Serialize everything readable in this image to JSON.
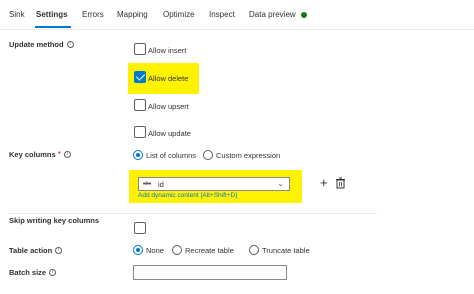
{
  "tabs": [
    {
      "label": "Sink"
    },
    {
      "label": "Settings"
    },
    {
      "label": "Errors"
    },
    {
      "label": "Mapping"
    },
    {
      "label": "Optimize"
    },
    {
      "label": "Inspect"
    },
    {
      "label": "Data preview"
    }
  ],
  "active_tab": "Settings",
  "update_method": {
    "label": "Update method",
    "options": [
      {
        "label": "Allow insert",
        "checked": false
      },
      {
        "label": "Allow delete",
        "checked": true
      },
      {
        "label": "Allow upsert",
        "checked": false
      },
      {
        "label": "Allow update",
        "checked": false
      }
    ]
  },
  "key_columns": {
    "label": "Key columns",
    "required_marker": "*",
    "modes": [
      {
        "label": "List of columns",
        "selected": true
      },
      {
        "label": "Custom expression",
        "selected": false
      }
    ],
    "column_value": "id",
    "type_icon_text": "abc",
    "dynamic_link": "Add dynamic content [Alt+Shift+D]"
  },
  "skip_writing": {
    "label": "Skip writing key columns",
    "checked": false
  },
  "table_action": {
    "label": "Table action",
    "options": [
      {
        "label": "None",
        "selected": true
      },
      {
        "label": "Recreate table",
        "selected": false
      },
      {
        "label": "Truncate table",
        "selected": false
      }
    ]
  },
  "batch_size": {
    "label": "Batch size",
    "value": ""
  },
  "colors": {
    "accent": "#0078d4",
    "highlight": "#fff200",
    "status_green": "#107c10"
  }
}
